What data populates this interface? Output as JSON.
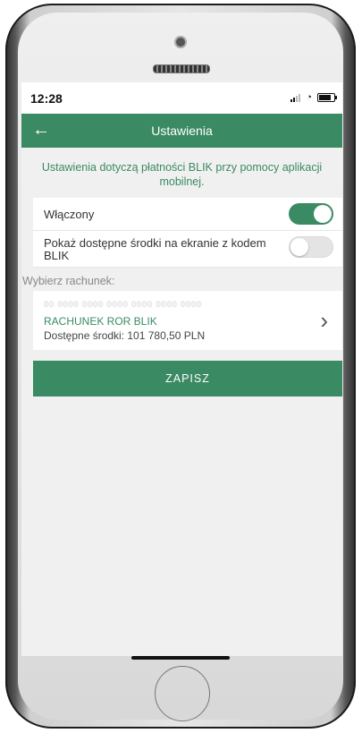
{
  "status_bar": {
    "time": "12:28"
  },
  "header": {
    "back_icon": "arrow-left-icon",
    "title": "Ustawienia"
  },
  "info_text": "Ustawienia dotyczą płatności BLIK przy pomocy aplikacji mobilnej.",
  "settings": {
    "enabled_label": "Włączony",
    "enabled_state": true,
    "show_funds_label": "Pokaż dostępne środki na ekranie z kodem BLIK",
    "show_funds_state": false
  },
  "account_section": {
    "label": "Wybierz rachunek:",
    "account_number": "00 0000 0000 0000 0000 0000 0000",
    "account_name": "RACHUNEK ROR BLIK",
    "balance": "Dostępne środki: 101 780,50 PLN"
  },
  "save_label": "ZAPISZ",
  "colors": {
    "accent": "#3a8a63"
  }
}
